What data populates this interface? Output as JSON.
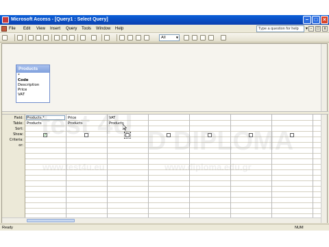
{
  "window": {
    "title": "Microsoft Access - [Query1 : Select Query]"
  },
  "menu": {
    "items": [
      "File",
      "Edit",
      "View",
      "Insert",
      "Query",
      "Tools",
      "Window",
      "Help"
    ],
    "help_placeholder": "Type a question for help"
  },
  "toolbar": {
    "combo_value": "All"
  },
  "field_list": {
    "table": "Products",
    "fields": [
      "*",
      "Code",
      "Description",
      "Price",
      "VAT"
    ],
    "key_field": "Code"
  },
  "grid": {
    "row_labels": [
      "Field:",
      "Table:",
      "Sort:",
      "Show:",
      "Criteria:",
      "or:"
    ],
    "columns": [
      {
        "field": "Products.*",
        "table": "Products",
        "show": true
      },
      {
        "field": "Price",
        "table": "Products",
        "show": false
      },
      {
        "field": "VAT",
        "table": "Products",
        "show": false
      },
      {
        "field": "",
        "table": "",
        "show": false
      },
      {
        "field": "",
        "table": "",
        "show": false
      },
      {
        "field": "",
        "table": "",
        "show": false
      },
      {
        "field": "",
        "table": "",
        "show": false
      }
    ]
  },
  "status": {
    "left": "Ready",
    "right": "NUM"
  },
  "watermark": {
    "brand1": "test 4U",
    "brand2": "D DIPLOMA",
    "url1": "www.test4u.eu",
    "url2": "www.diploma.edu.gr"
  }
}
